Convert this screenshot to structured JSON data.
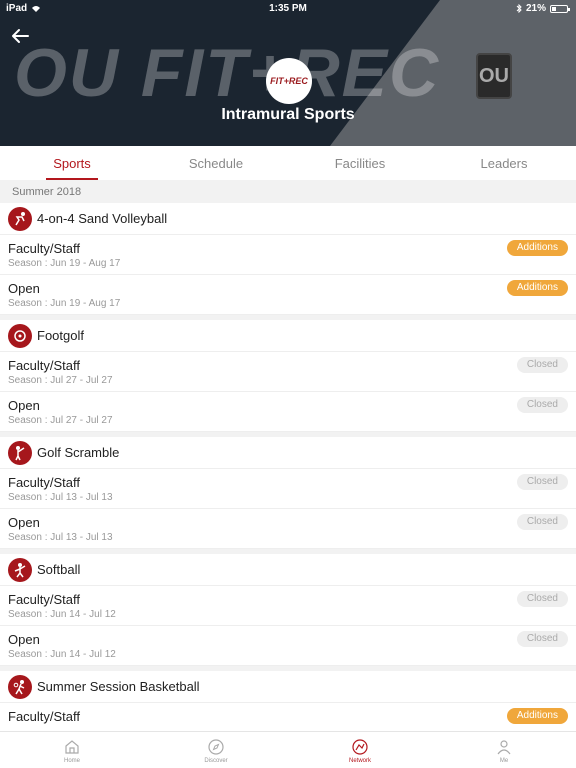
{
  "status_bar": {
    "device": "iPad",
    "time": "1:35 PM",
    "battery": "21%"
  },
  "header": {
    "title": "Intramural Sports",
    "bg_text": "OU FIT+REC",
    "badge_text": "FIT+REC",
    "corner_logo_text": "OU"
  },
  "tabs": [
    {
      "label": "Sports",
      "active": true
    },
    {
      "label": "Schedule",
      "active": false
    },
    {
      "label": "Facilities",
      "active": false
    },
    {
      "label": "Leaders",
      "active": false
    }
  ],
  "season_label": "Summer 2018",
  "sports": [
    {
      "name": "4-on-4 Sand Volleyball",
      "icon": "volleyball-icon",
      "divisions": [
        {
          "name": "Faculty/Staff",
          "season": "Season : Jun 19 - Aug 17",
          "status": "Additions"
        },
        {
          "name": "Open",
          "season": "Season : Jun 19 - Aug 17",
          "status": "Additions"
        }
      ]
    },
    {
      "name": "Footgolf",
      "icon": "footgolf-icon",
      "divisions": [
        {
          "name": "Faculty/Staff",
          "season": "Season : Jul 27 - Jul 27",
          "status": "Closed"
        },
        {
          "name": "Open",
          "season": "Season : Jul 27 - Jul 27",
          "status": "Closed"
        }
      ]
    },
    {
      "name": "Golf Scramble",
      "icon": "golf-icon",
      "divisions": [
        {
          "name": "Faculty/Staff",
          "season": "Season : Jul 13 - Jul 13",
          "status": "Closed"
        },
        {
          "name": "Open",
          "season": "Season : Jul 13 - Jul 13",
          "status": "Closed"
        }
      ]
    },
    {
      "name": "Softball",
      "icon": "softball-icon",
      "divisions": [
        {
          "name": "Faculty/Staff",
          "season": "Season : Jun 14 - Jul 12",
          "status": "Closed"
        },
        {
          "name": "Open",
          "season": "Season : Jun 14 - Jul 12",
          "status": "Closed"
        }
      ]
    },
    {
      "name": "Summer Session Basketball",
      "icon": "basketball-icon",
      "divisions": [
        {
          "name": "Faculty/Staff",
          "season": "",
          "status": "Additions"
        }
      ]
    }
  ],
  "bottom_nav": [
    {
      "label": "Home",
      "icon": "home-icon",
      "active": false
    },
    {
      "label": "Discover",
      "icon": "compass-icon",
      "active": false
    },
    {
      "label": "Network",
      "icon": "network-icon",
      "active": true
    },
    {
      "label": "Me",
      "icon": "person-icon",
      "active": false
    }
  ],
  "colors": {
    "primary": "#b3171d",
    "additions": "#f0a73b",
    "closed_bg": "#eeeeee",
    "header_bg": "#1b2530"
  }
}
